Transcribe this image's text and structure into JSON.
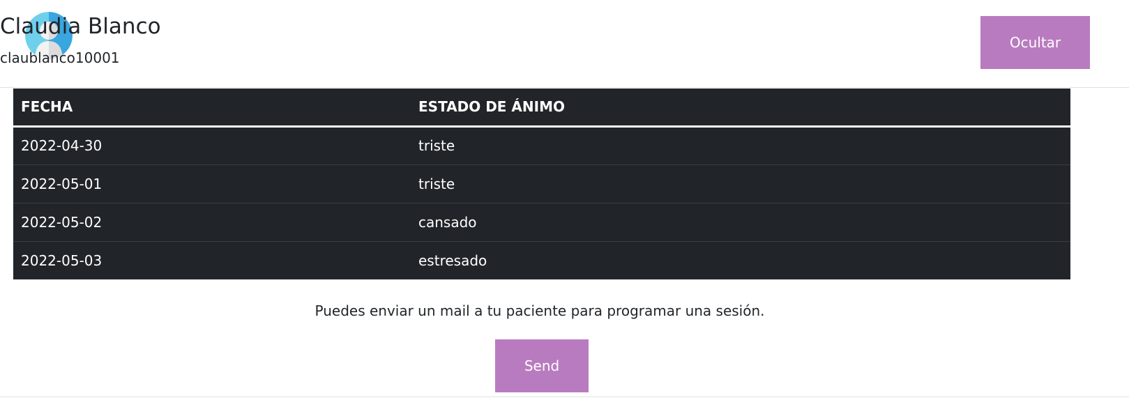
{
  "header": {
    "patient_name": "Claudia Blanco",
    "patient_username": "claublanco10001",
    "hide_label": "Ocultar",
    "avatar_icon": "user-avatar-icon"
  },
  "table": {
    "columns": [
      "FECHA",
      "ESTADO DE ÁNIMO"
    ],
    "rows": [
      {
        "date": "2022-04-30",
        "mood": "triste"
      },
      {
        "date": "2022-05-01",
        "mood": "triste"
      },
      {
        "date": "2022-05-02",
        "mood": "cansado"
      },
      {
        "date": "2022-05-03",
        "mood": "estresado"
      }
    ]
  },
  "footer": {
    "message": "Puedes enviar un mail a tu paciente para programar una sesión.",
    "send_label": "Send"
  },
  "colors": {
    "accent": "#b97bbf",
    "table_bg": "#212529",
    "avatar_bg": "#5bc4e8"
  }
}
